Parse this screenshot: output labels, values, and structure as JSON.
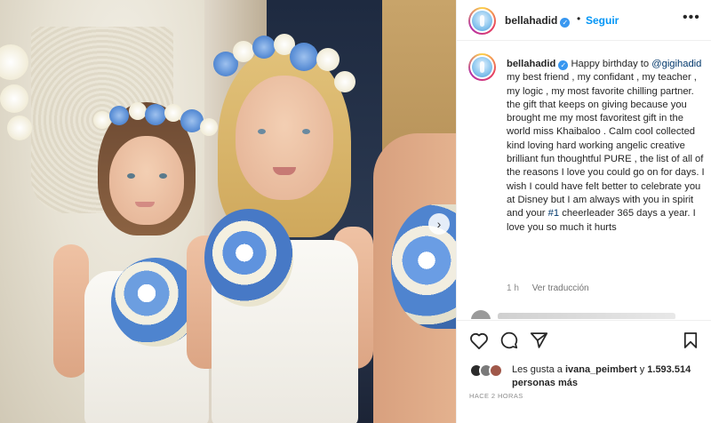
{
  "post": {
    "username": "bellahadid",
    "verified_mark": "✓",
    "follow_label": "Seguir",
    "header_separator": "•",
    "more_label": "•••"
  },
  "caption": {
    "username": "bellahadid",
    "text_1": "Happy birthday to",
    "mention": "@gigihadid",
    "text_2": "my best friend , my confidant , my teacher , my logic , my most favorite chilling partner. the gift that keeps on giving because you brought me my most favoritest gift in the world miss Khaibaloo . Calm cool collected kind loving hard working angelic creative brilliant fun thoughtful PURE , the list of all of the reasons I love you could go on for days. I wish I could have felt better to celebrate you at Disney but I am always with you in spirit and your",
    "hashtag": "#1",
    "text_3": "cheerleader 365 days a year. I love you so much it hurts"
  },
  "meta": {
    "time": "1 h",
    "translate_label": "Ver traducción"
  },
  "likes": {
    "prefix": "Les gusta a",
    "user": "ivana_peimbert",
    "connector": "y",
    "count": "1.593.514",
    "suffix": "personas más"
  },
  "posted_ago": "HACE 2 HORAS",
  "icons": {
    "like": "heart-icon",
    "comment": "comment-icon",
    "share": "share-icon",
    "save": "bookmark-icon",
    "carousel_next": "chevron-right-icon"
  },
  "colors": {
    "link_blue": "#0095f6",
    "mention_blue": "#00376b",
    "verified_blue": "#3897f0",
    "meta_gray": "#8e8e8e"
  }
}
